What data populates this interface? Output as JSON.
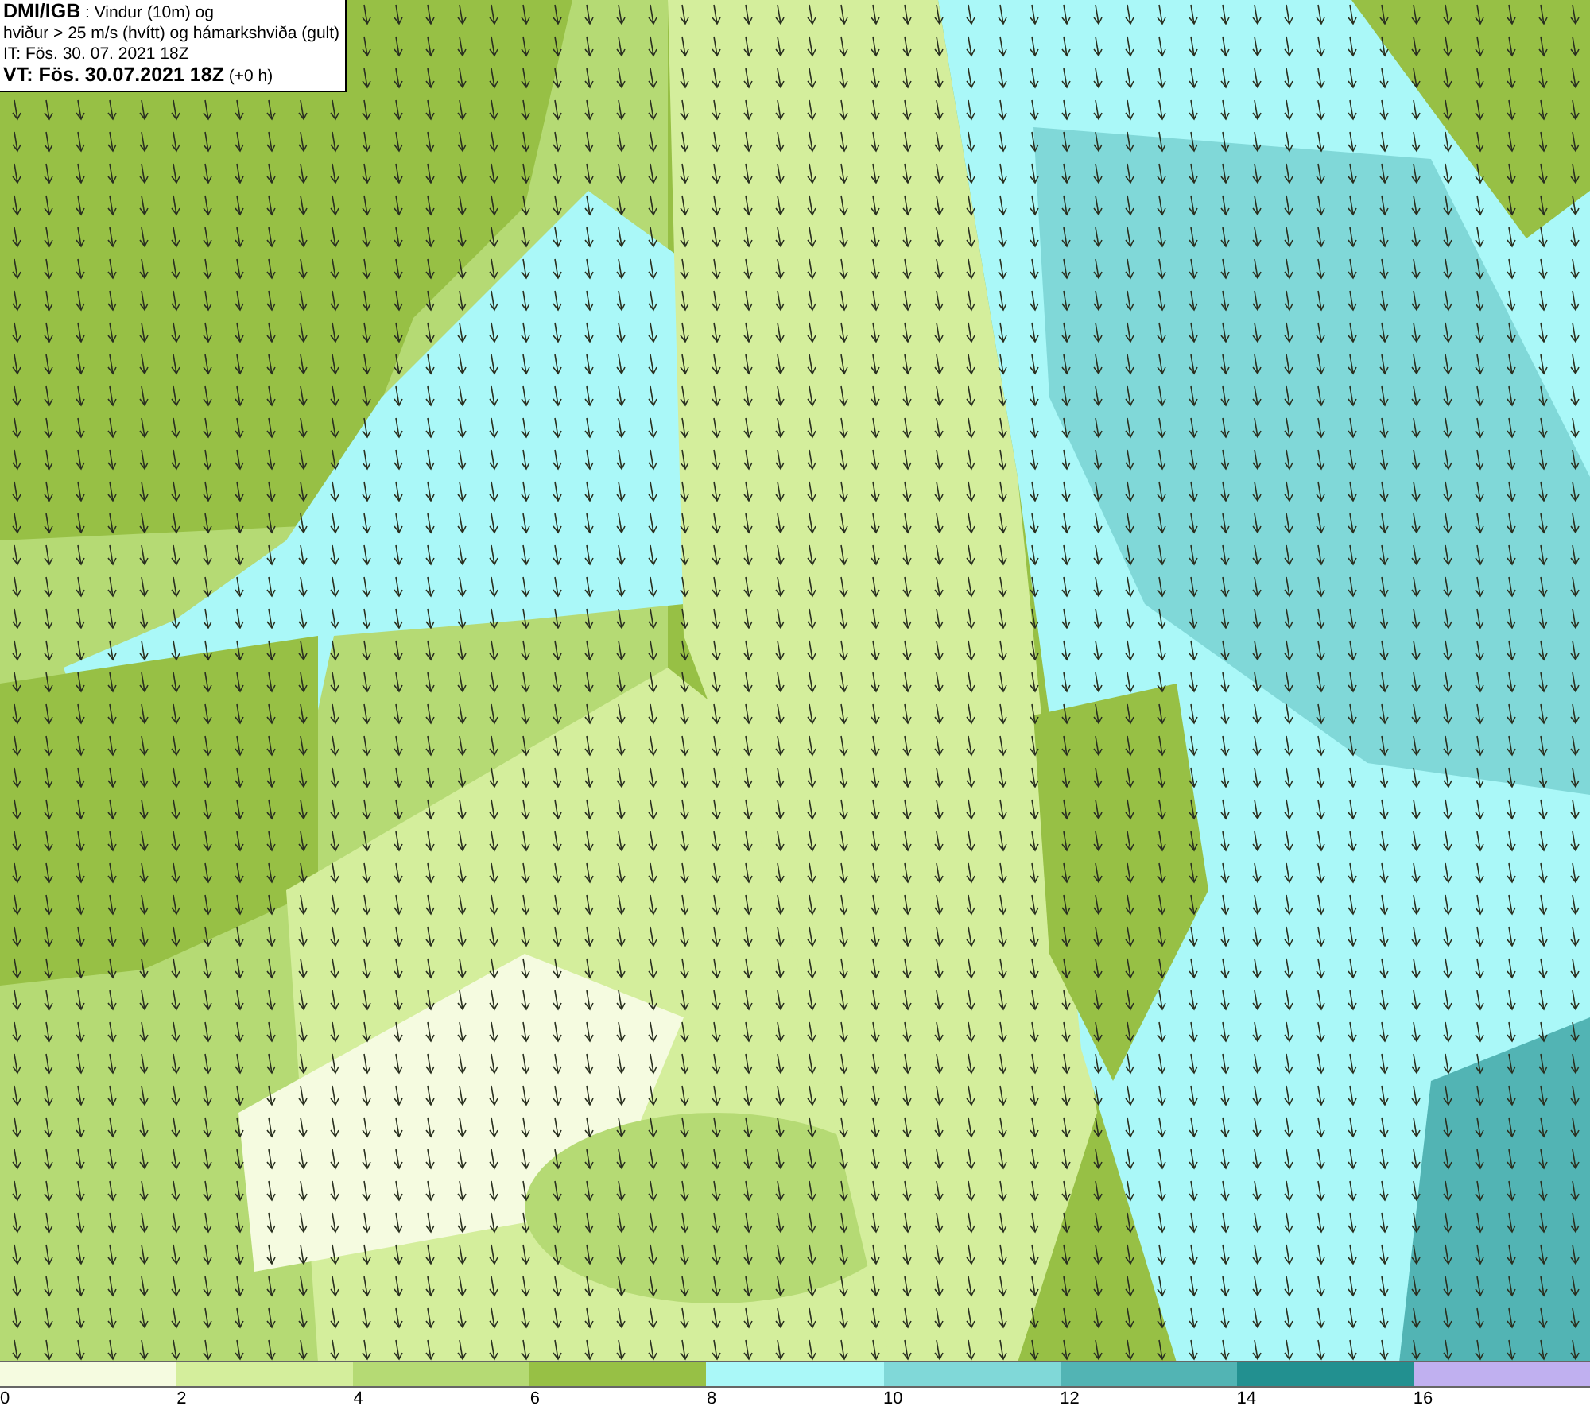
{
  "header": {
    "lines": [
      "**DMI/IGB** : Vindur (10m) og",
      "hviður > 25 m/s (hvítt) og hámarkshviða (gult)",
      "IT: Fös. 30. 07. 2021 18Z",
      "**VT: Fös. 30.07.2021 18Z** (+0 h)"
    ]
  },
  "legend": {
    "bins": [
      {
        "color": "#f5fbe0"
      },
      {
        "color": "#d4ee9c"
      },
      {
        "color": "#b5da74"
      },
      {
        "color": "#97c045"
      },
      {
        "color": "#aaf8f8"
      },
      {
        "color": "#80d8d8"
      },
      {
        "color": "#52b4b4"
      },
      {
        "color": "#229090"
      },
      {
        "color": "#c0b0f0"
      }
    ],
    "ticks": [
      "0",
      "2",
      "4",
      "6",
      "8",
      "10",
      "12",
      "14",
      "16"
    ]
  }
}
